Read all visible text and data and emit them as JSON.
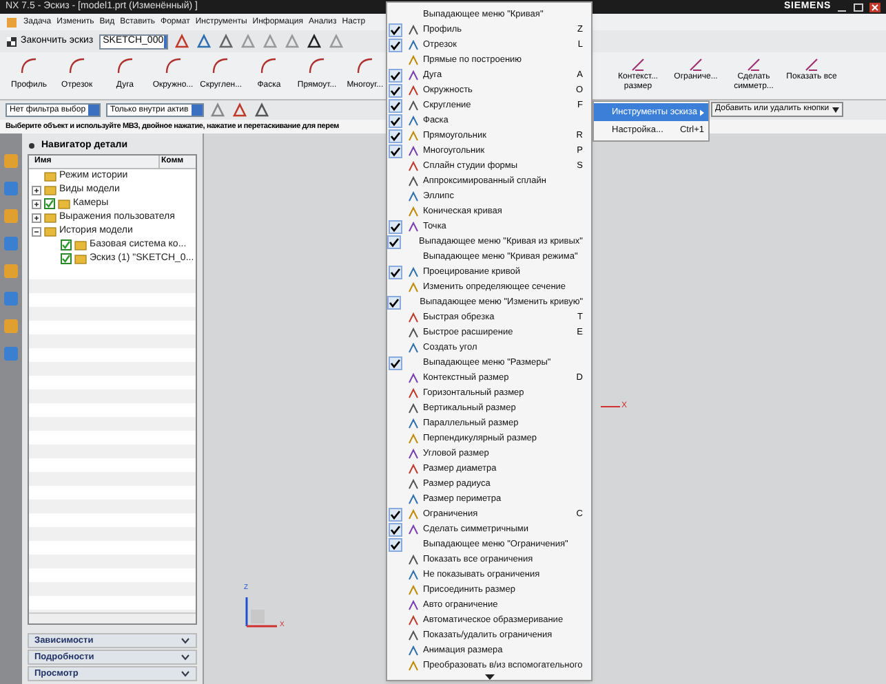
{
  "window": {
    "title": "NX 7.5 - Эскиз - [model1.prt (Изменённый) ]",
    "brand": "SIEMENS"
  },
  "menubar": [
    "Задача",
    "Изменить",
    "Вид",
    "Вставить",
    "Формат",
    "Инструменты",
    "Информация",
    "Анализ",
    "Настр"
  ],
  "sketch_toolbar": {
    "finish": "Закончить эскиз",
    "sketch_name": "SKETCH_000"
  },
  "curve_tools": [
    "Профиль",
    "Отрезок",
    "Дуга",
    "Окружно...",
    "Скруглен...",
    "Фаска",
    "Прямоут...",
    "Многоуг..."
  ],
  "constraint_tools": [
    "Контекст... размер",
    "Ограниче...",
    "Сделать симметр...",
    "Показать все"
  ],
  "filters": [
    "Нет фильтра выбор",
    "Только внутри актив"
  ],
  "status": "Выберите объект и используйте МВЗ, двойное нажатие, нажатие и перетаскивание для перем",
  "popup_menu": {
    "items": [
      {
        "label": "Выпадающее меню \"Кривая\"",
        "kind": "submenu",
        "checked": false
      },
      {
        "label": "Профиль",
        "shortcut": "Z",
        "kind": "command",
        "checked": true
      },
      {
        "label": "Отрезок",
        "shortcut": "L",
        "kind": "command",
        "checked": true
      },
      {
        "label": "Прямые по построению",
        "kind": "command",
        "checked": false
      },
      {
        "label": "Дуга",
        "shortcut": "A",
        "kind": "command",
        "checked": true
      },
      {
        "label": "Окружность",
        "shortcut": "O",
        "kind": "command",
        "checked": true
      },
      {
        "label": "Скругление",
        "shortcut": "F",
        "kind": "command",
        "checked": true
      },
      {
        "label": "Фаска",
        "kind": "command",
        "checked": true
      },
      {
        "label": "Прямоугольник",
        "shortcut": "R",
        "kind": "command",
        "checked": true
      },
      {
        "label": "Многоугольник",
        "shortcut": "P",
        "kind": "command",
        "checked": true
      },
      {
        "label": "Сплайн студии формы",
        "shortcut": "S",
        "kind": "command",
        "checked": false
      },
      {
        "label": "Аппроксимированный сплайн",
        "kind": "command",
        "checked": false
      },
      {
        "label": "Эллипс",
        "kind": "command",
        "checked": false
      },
      {
        "label": "Коническая кривая",
        "kind": "command",
        "checked": false
      },
      {
        "label": "Точка",
        "kind": "command",
        "checked": true
      },
      {
        "label": "Выпадающее меню \"Кривая из кривых\"",
        "kind": "submenu",
        "checked": true
      },
      {
        "label": "Выпадающее меню \"Кривая режима\"",
        "kind": "submenu",
        "checked": false
      },
      {
        "label": "Проецирование кривой",
        "kind": "command",
        "checked": true
      },
      {
        "label": "Изменить определяющее сечение",
        "kind": "command",
        "checked": false
      },
      {
        "label": "Выпадающее меню \"Изменить кривую\"",
        "kind": "submenu",
        "checked": true
      },
      {
        "label": "Быстрая обрезка",
        "shortcut": "T",
        "kind": "command",
        "checked": false
      },
      {
        "label": "Быстрое расширение",
        "shortcut": "E",
        "kind": "command",
        "checked": false
      },
      {
        "label": "Создать угол",
        "kind": "command",
        "checked": false
      },
      {
        "label": "Выпадающее меню \"Размеры\"",
        "kind": "submenu",
        "checked": true
      },
      {
        "label": "Контекстный размер",
        "shortcut": "D",
        "kind": "command",
        "checked": false
      },
      {
        "label": "Горизонтальный размер",
        "kind": "command",
        "checked": false
      },
      {
        "label": "Вертикальный размер",
        "kind": "command",
        "checked": false
      },
      {
        "label": "Параллельный размер",
        "kind": "command",
        "checked": false
      },
      {
        "label": "Перпендикулярный размер",
        "kind": "command",
        "checked": false
      },
      {
        "label": "Угловой размер",
        "kind": "command",
        "checked": false
      },
      {
        "label": "Размер диаметра",
        "kind": "command",
        "checked": false
      },
      {
        "label": "Размер радиуса",
        "kind": "command",
        "checked": false
      },
      {
        "label": "Размер периметра",
        "kind": "command",
        "checked": false
      },
      {
        "label": "Ограничения",
        "shortcut": "C",
        "kind": "command",
        "checked": true
      },
      {
        "label": "Сделать симметричными",
        "kind": "command",
        "checked": true
      },
      {
        "label": "Выпадающее меню \"Ограничения\"",
        "kind": "submenu",
        "checked": true
      },
      {
        "label": "Показать все ограничения",
        "kind": "command",
        "checked": false
      },
      {
        "label": "Не показывать ограничения",
        "kind": "command",
        "checked": false
      },
      {
        "label": "Присоединить размер",
        "kind": "command",
        "checked": false
      },
      {
        "label": "Авто ограничение",
        "kind": "command",
        "checked": false
      },
      {
        "label": "Автоматическое образмеривание",
        "kind": "command",
        "checked": false
      },
      {
        "label": "Показать/удалить ограничения",
        "kind": "command",
        "checked": false
      },
      {
        "label": "Анимация размера",
        "kind": "command",
        "checked": false
      },
      {
        "label": "Преобразовать в/из вспомогательного",
        "kind": "command",
        "checked": false
      }
    ]
  },
  "submenu": {
    "items": [
      {
        "label": "Инструменты эскиза",
        "selected": true
      },
      {
        "label": "Настройка...",
        "shortcut": "Ctrl+1",
        "selected": false
      }
    ]
  },
  "add_remove": "Добавить или удалить кнопки",
  "navigator": {
    "title": "Навигатор детали",
    "columns": [
      "Имя",
      "Комм"
    ],
    "tree": [
      {
        "label": "Режим истории",
        "checked": false
      },
      {
        "label": "Виды модели",
        "expanded": false,
        "checked": false
      },
      {
        "label": "Камеры",
        "expanded": false,
        "checked": true
      },
      {
        "label": "Выражения пользователя",
        "expanded": false,
        "checked": false
      },
      {
        "label": "История модели",
        "expanded": true,
        "checked": false,
        "children": [
          {
            "label": "Базовая система ко...",
            "checked": true
          },
          {
            "label": "Эскиз (1) \"SKETCH_0...",
            "checked": true
          }
        ]
      }
    ]
  },
  "panels": [
    "Зависимости",
    "Подробности",
    "Просмотр"
  ],
  "graphics": {
    "axis_label": "X",
    "triad_labels": [
      "Z",
      "X"
    ]
  }
}
